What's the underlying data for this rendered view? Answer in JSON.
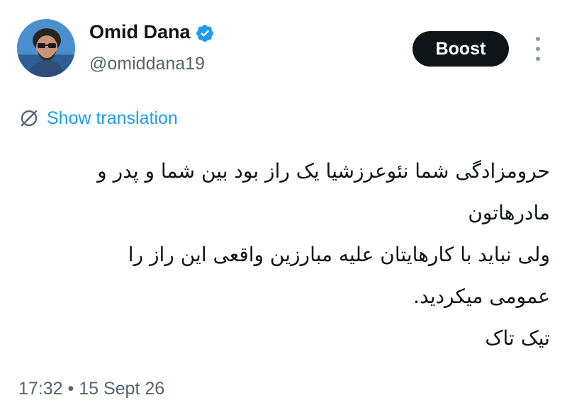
{
  "author": {
    "display_name": "Omid Dana",
    "handle": "@omiddana19",
    "verified": true,
    "avatar_icon": "avatar-photo"
  },
  "actions": {
    "boost_label": "Boost",
    "more_icon": "more-vertical-icon"
  },
  "translation": {
    "label": "Show translation",
    "icon": "translate-icon",
    "color": "#1d9bf0"
  },
  "tweet": {
    "lines": [
      "حرومزادگی شما نئوعرزشیا یک راز بود بین شما و پدر و",
      "مادرهاتون",
      "ولی نباید با کارهایتان علیه مبارزین واقعی این راز را",
      "عمومی میکردید.",
      "تیک تاک"
    ]
  },
  "meta": {
    "timestamp": "17:32 • 15 Sept 26"
  },
  "colors": {
    "text": "#0f1419",
    "secondary": "#536471",
    "verified": "#1d9bf0",
    "button_bg": "#0f1419"
  }
}
